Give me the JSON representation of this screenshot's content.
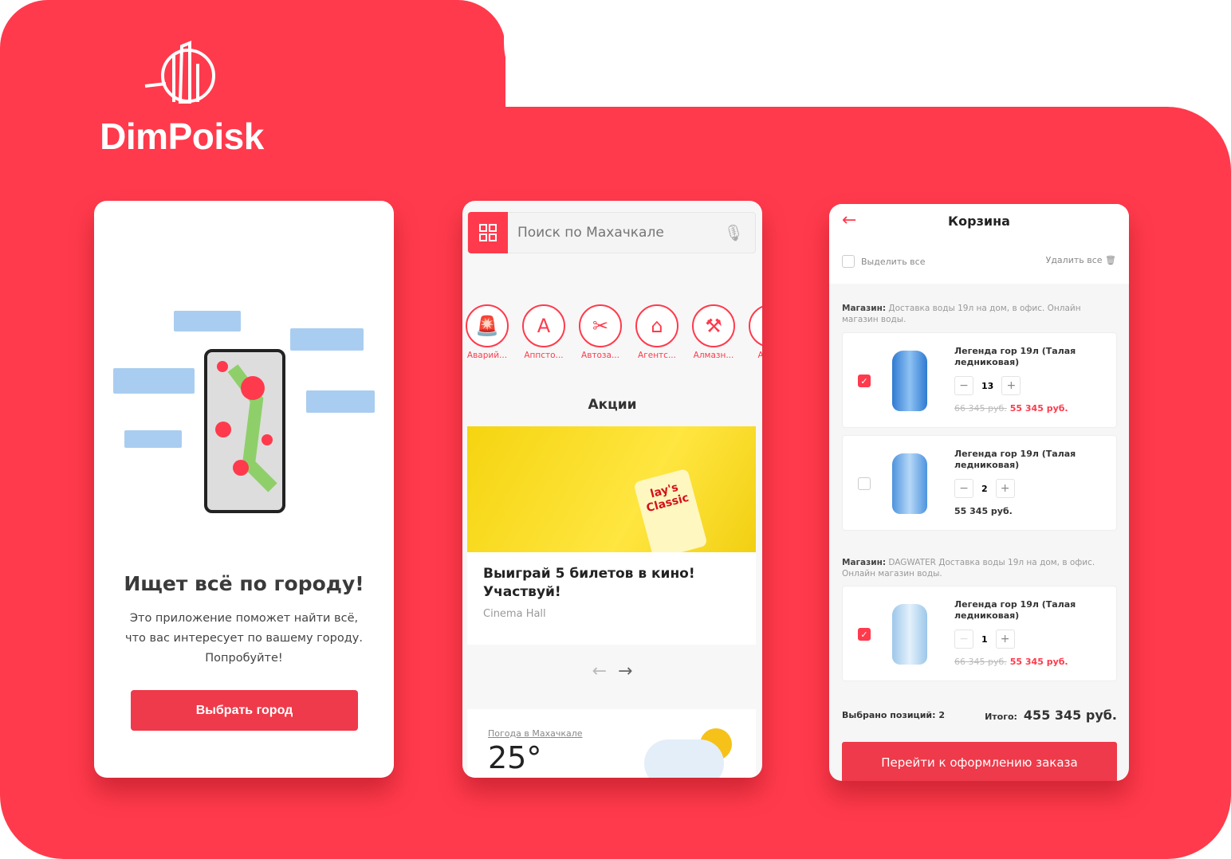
{
  "brand": {
    "name": "DimPoisk",
    "accent": "#FF3A4C"
  },
  "onboarding": {
    "title": "Ищет всё по городу!",
    "description": "Это приложение поможет найти всё, что вас интересует по вашему городу. Попробуйте!",
    "button": "Выбрать город"
  },
  "home": {
    "search_placeholder": "Поиск по Махачкале",
    "categories": [
      {
        "label": "Аварий...",
        "icon": "siren-icon"
      },
      {
        "label": "Аппсто...",
        "icon": "appstore-icon"
      },
      {
        "label": "Автоза...",
        "icon": "tools-icon"
      },
      {
        "label": "Агентс...",
        "icon": "house-icon"
      },
      {
        "label": "Алмазн...",
        "icon": "grinder-icon"
      },
      {
        "label": "Апп...",
        "icon": "appstore-icon"
      }
    ],
    "promos_heading": "Акции",
    "promo": {
      "title": "Выиграй 5 билетов в кино! Участвуй!",
      "source": "Cinema Hall",
      "image_text": "lay's Classic"
    },
    "weather": {
      "label": "Погода в Махачкале",
      "temperature": "25°"
    }
  },
  "cart": {
    "title": "Корзина",
    "select_all": "Выделить все",
    "delete_all": "Удалить все",
    "shops": [
      {
        "label": "Магазин:",
        "name": "Доставка воды 19л на дом, в офис. Онлайн магазин воды.",
        "items": [
          {
            "name": "Легенда гор 19л (Талая ледниковая)",
            "qty": "13",
            "old_price": "66 345 руб.",
            "price": "55 345 руб.",
            "checked": true
          },
          {
            "name": "Легенда гор 19л (Талая ледниковая)",
            "qty": "2",
            "old_price": "",
            "price": "55 345 руб.",
            "checked": false
          }
        ]
      },
      {
        "label": "Магазин:",
        "name": "DAGWATER Доставка воды 19л на дом, в офис. Онлайн магазин воды.",
        "items": [
          {
            "name": "Легенда гор 19л (Талая ледниковая)",
            "qty": "1",
            "old_price": "66 345 руб.",
            "price": "55 345 руб.",
            "checked": true
          }
        ]
      }
    ],
    "selected_label": "Выбрано позиций: 2",
    "total_label": "Итого:",
    "total": "455 345 руб.",
    "checkout": "Перейти к оформлению заказа"
  }
}
